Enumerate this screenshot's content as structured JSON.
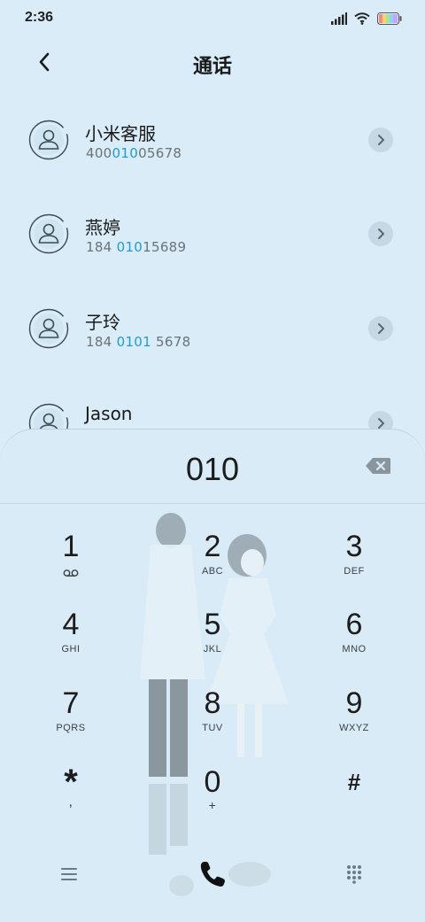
{
  "status": {
    "time": "2:36"
  },
  "header": {
    "title": "通话"
  },
  "contacts": [
    {
      "name": "小米客服",
      "num_pre": "400",
      "num_hl": "010",
      "num_post": "05678"
    },
    {
      "name": "燕婷",
      "num_pre": "184 ",
      "num_hl": "010",
      "num_post": "15689"
    },
    {
      "name": "子玲",
      "num_pre": "184 ",
      "num_hl": "0101",
      "num_post": " 5678"
    },
    {
      "name": "Jason",
      "num_pre": "",
      "num_hl": "",
      "num_post": ""
    }
  ],
  "dialpad": {
    "input": "010",
    "keys": [
      {
        "digit": "1",
        "letters": ""
      },
      {
        "digit": "2",
        "letters": "ABC"
      },
      {
        "digit": "3",
        "letters": "DEF"
      },
      {
        "digit": "4",
        "letters": "GHI"
      },
      {
        "digit": "5",
        "letters": "JKL"
      },
      {
        "digit": "6",
        "letters": "MNO"
      },
      {
        "digit": "7",
        "letters": "PQRS"
      },
      {
        "digit": "8",
        "letters": "TUV"
      },
      {
        "digit": "9",
        "letters": "WXYZ"
      },
      {
        "digit": "*",
        "letters": ","
      },
      {
        "digit": "0",
        "letters": "+"
      },
      {
        "digit": "#",
        "letters": ""
      }
    ]
  },
  "icons": {
    "back": "chevron-left-icon",
    "contact_avatar": "person-icon",
    "contact_detail": "chevron-right-icon",
    "backspace": "backspace-icon",
    "voicemail": "voicemail-icon",
    "menu": "menu-icon",
    "call": "phone-icon",
    "keypad": "keypad-icon"
  },
  "colors": {
    "background": "#d9ecf7",
    "highlight": "#1f9bd6",
    "text": "#1c1c1c"
  }
}
